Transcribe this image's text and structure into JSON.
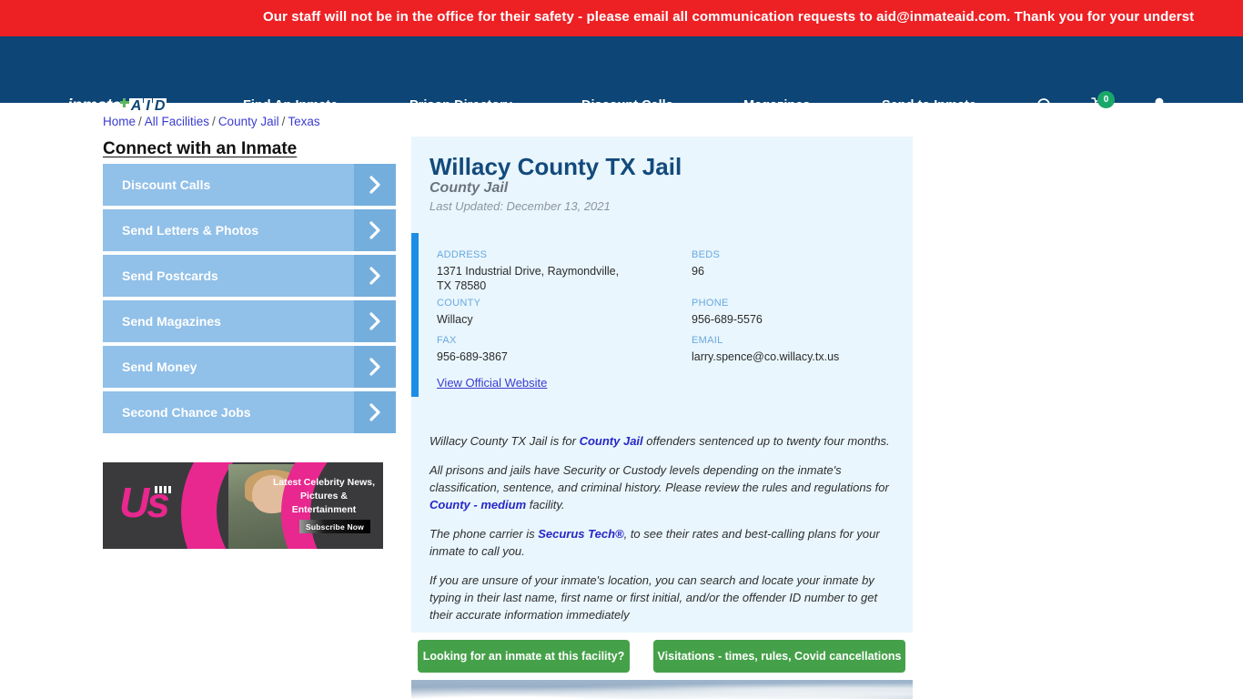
{
  "alert": {
    "message": "Our staff will not be in the office for their safety - please email all communication requests to aid@inmateaid.com. Thank you for your underst",
    "bg_color": "#ed2024"
  },
  "navbar": {
    "bg_color": "#0c4576",
    "logo": {
      "word": "inmate",
      "a": "A",
      "i": "I",
      "d": "D"
    },
    "links": [
      {
        "label": "Find An Inmate"
      },
      {
        "label": "Prison Directory"
      },
      {
        "label": "Discount Calls"
      },
      {
        "label": "Magazines"
      },
      {
        "label": "Send to Inmate"
      }
    ],
    "icons": {
      "search": "search-icon",
      "cart": "cart-icon",
      "user": "user-icon"
    },
    "cart_count": "0",
    "cart_badge_color": "#1aa76a"
  },
  "breadcrumb": {
    "items": [
      "Home",
      "All Facilities",
      "County Jail",
      "Texas"
    ],
    "separator": "/"
  },
  "sidebar": {
    "title": "Connect with an Inmate",
    "items": [
      {
        "label": "Discount Calls"
      },
      {
        "label": "Send Letters & Photos"
      },
      {
        "label": "Send Postcards"
      },
      {
        "label": "Send Magazines"
      },
      {
        "label": "Send Money"
      },
      {
        "label": "Second Chance Jobs"
      }
    ],
    "button_color": "#91c0e8",
    "arrow_color": "#74aedd"
  },
  "ad": {
    "brand": "Us",
    "headline": "Latest Celebrity News, Pictures & Entertainment",
    "cta": "Subscribe Now",
    "accent_color": "#e8278f"
  },
  "facility": {
    "name": "Willacy County TX Jail",
    "type": "County Jail",
    "last_updated": "Last Updated: December 13, 2021",
    "accent_bar_color": "#1c8de6",
    "card_bg": "#e9f6fd",
    "info": {
      "address_label": "ADDRESS",
      "address_value": "1371 Industrial Drive, Raymondville, TX 78580",
      "beds_label": "BEDS",
      "beds_value": "96",
      "county_label": "COUNTY",
      "county_value": "Willacy",
      "phone_label": "PHONE",
      "phone_value": "956-689-5576",
      "fax_label": "FAX",
      "fax_value": "956-689-3867",
      "email_label": "EMAIL",
      "email_value": "larry.spence@co.willacy.tx.us"
    },
    "official_website_link": "View Official Website",
    "description": {
      "p1_a": "Willacy County TX Jail is for ",
      "p1_link": "County Jail",
      "p1_b": " offenders sentenced up to twenty four months.",
      "p2_a": "All prisons and jails have Security or Custody levels depending on the inmate's classification, sentence, and criminal history. Please review the rules and regulations for ",
      "p2_link": "County - medium",
      "p2_b": " facility.",
      "p3_a": "The phone carrier is ",
      "p3_link": "Securus Tech®",
      "p3_b": ", to see their rates and best-calling plans for your inmate to call you.",
      "p4": "If you are unsure of your inmate's location, you can search and locate your inmate by typing in their last name, first name or first initial, and/or the offender ID number to get their accurate information immediately"
    }
  },
  "actions": {
    "button_color": "#45a149",
    "looking_label": "Looking for an inmate at this facility?",
    "visitations_label": "Visitations - times, rules, Covid cancellations"
  }
}
